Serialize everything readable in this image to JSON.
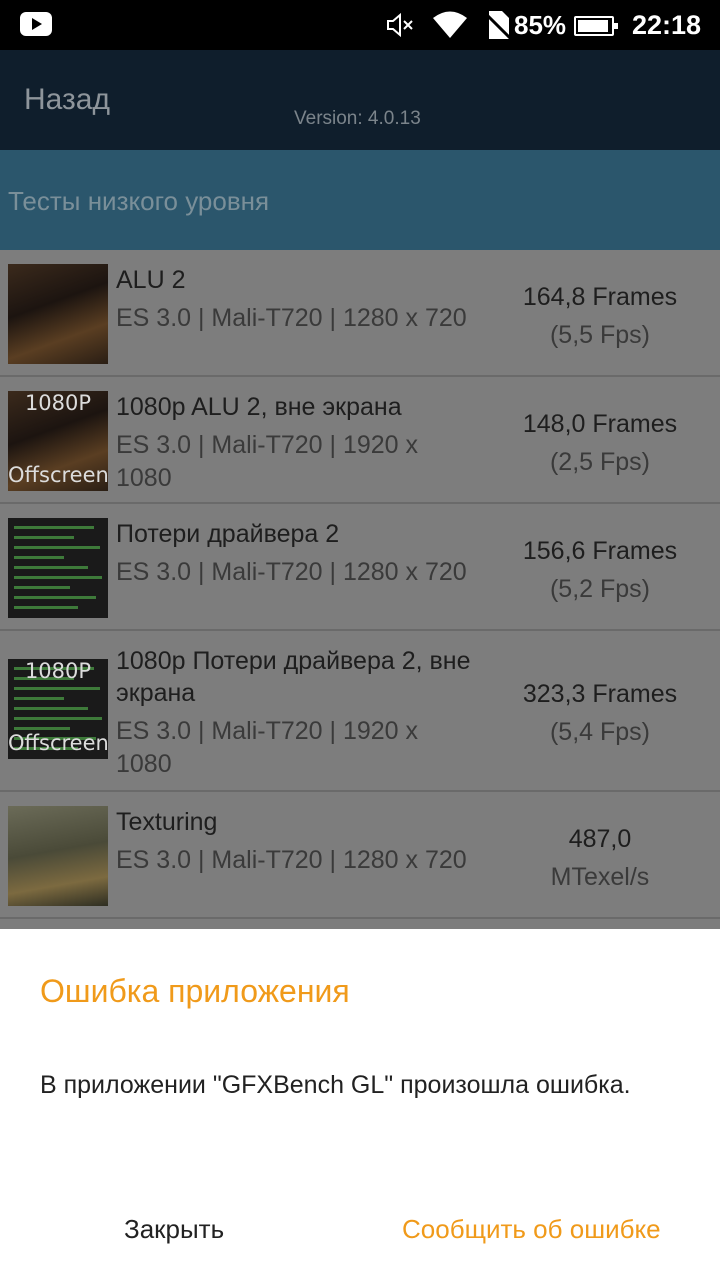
{
  "status_bar": {
    "battery_percent": "85%",
    "time": "22:18",
    "icons": [
      "youtube-icon",
      "mute-icon",
      "wifi-icon",
      "no-sim-icon",
      "battery-charging-icon"
    ]
  },
  "header": {
    "back_label": "Назад",
    "version": "Version: 4.0.13"
  },
  "section": {
    "title": "Тесты низкого уровня"
  },
  "tests": [
    {
      "title": "ALU 2",
      "subtitle": "ES 3.0 | Mali-T720 | 1280 x 720",
      "value": "164,8 Frames",
      "secondary": "(5,5 Fps)",
      "thumb_tag_top": "",
      "thumb_tag_bottom": ""
    },
    {
      "title": "1080p ALU 2, вне экрана",
      "subtitle": "ES 3.0 | Mali-T720 | 1920 x 1080",
      "value": "148,0 Frames",
      "secondary": "(2,5 Fps)",
      "thumb_tag_top": "1080P",
      "thumb_tag_bottom": "Offscreen"
    },
    {
      "title": "Потери драйвера 2",
      "subtitle": "ES 3.0 | Mali-T720 | 1280 x 720",
      "value": "156,6 Frames",
      "secondary": "(5,2 Fps)",
      "thumb_tag_top": "",
      "thumb_tag_bottom": ""
    },
    {
      "title": "1080p Потери драйвера 2, вне экрана",
      "subtitle": "ES 3.0 | Mali-T720 | 1920 x 1080",
      "value": "323,3 Frames",
      "secondary": "(5,4 Fps)",
      "thumb_tag_top": "1080P",
      "thumb_tag_bottom": "Offscreen"
    },
    {
      "title": "Texturing",
      "subtitle": "ES 3.0 | Mali-T720 | 1280 x 720",
      "value": "487,0",
      "secondary": "MTexel/s",
      "thumb_tag_top": "",
      "thumb_tag_bottom": ""
    }
  ],
  "dialog": {
    "title": "Ошибка приложения",
    "message": "В приложении \"GFXBench GL\" произошла ошибка.",
    "close_label": "Закрыть",
    "report_label": "Сообщить об ошибке"
  },
  "colors": {
    "accent": "#f09a1a",
    "header_bg": "#0f1e2c",
    "section_bg": "#2b566c"
  }
}
